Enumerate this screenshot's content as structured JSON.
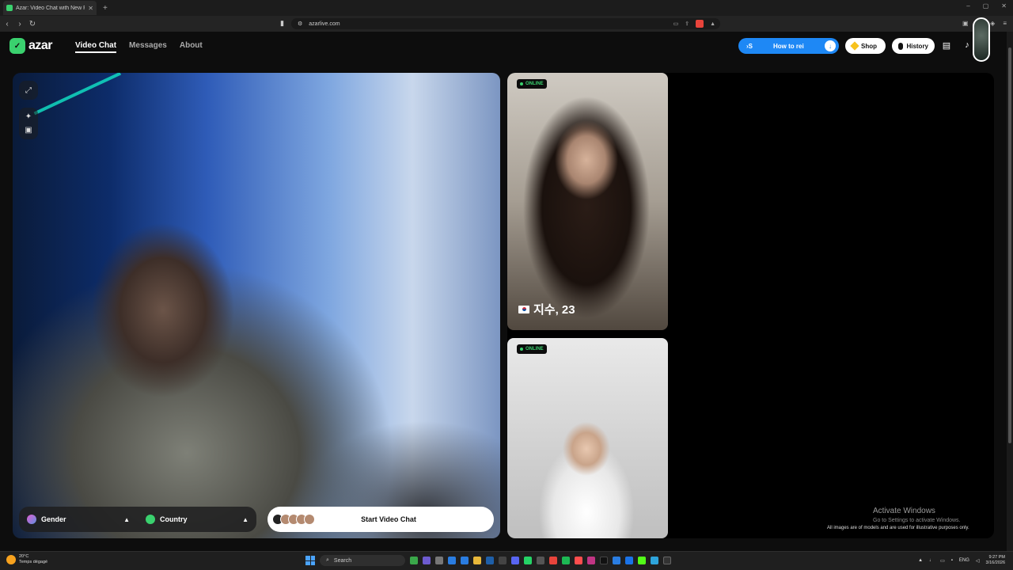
{
  "browser": {
    "tab_title": "Azar: Video Chat with New P...",
    "url": "azarlive.com",
    "back": "‹",
    "forward": "›",
    "reload": "↻",
    "new_tab": "+"
  },
  "header": {
    "logo": "azar",
    "nav": [
      {
        "label": "Video Chat",
        "active": true
      },
      {
        "label": "Messages",
        "active": false
      },
      {
        "label": "About",
        "active": false
      }
    ],
    "howto_prefix": "›S",
    "howto_label": "How to rei",
    "shop_label": "Shop",
    "history_label": "History"
  },
  "video": {
    "gender_label": "Gender",
    "country_label": "Country",
    "start_label": "Start Video Chat"
  },
  "previews": [
    {
      "status": "ONLINE",
      "name": "지수, 23"
    },
    {
      "status": "ONLINE"
    }
  ],
  "watermark": {
    "title": "Activate Windows",
    "subtitle": "Go to Settings to activate Windows.",
    "disclaimer": "All images are of models and are used for illustrative purposes only."
  },
  "taskbar": {
    "temp": "20°C",
    "weather": "Temps dégagé",
    "search": "Search",
    "lang": "ENG",
    "time": "9:27 PM",
    "date": "3/16/2026"
  },
  "colors": {
    "accent_green": "#3ad16e",
    "howto_blue": "#1e88f5"
  }
}
